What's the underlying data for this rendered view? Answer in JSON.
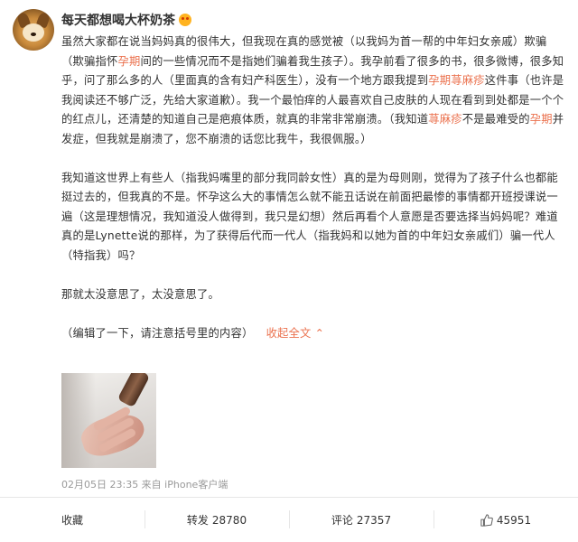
{
  "user": {
    "name": "每天都想喝大杯奶茶"
  },
  "post": {
    "paragraphs": [
      [
        {
          "t": "虽然大家都在说当妈妈真的很伟大，但我现在真的感觉被（以我妈为首一帮的中年妇女亲戚）欺骗（欺骗指怀"
        },
        {
          "t": "孕期",
          "kw": true
        },
        {
          "t": "间的一些情况而不是指她们骗着我生孩子）。我孕前看了很多的书，很多微博，很多知乎，问了那么多的人（里面真的含有妇产科医生），没有一个地方跟我提到"
        },
        {
          "t": "孕期荨麻疹",
          "kw": true
        },
        {
          "t": "这件事（也许是我阅读还不够广泛，先给大家道歉）。我一个最怕痒的人最喜欢自己皮肤的人现在看到到处都是一个个的红点儿，还清楚的知道自己是疤痕体质，就真的非常非常崩溃。（我知道"
        },
        {
          "t": "荨麻疹",
          "kw": true
        },
        {
          "t": "不是最难受的"
        },
        {
          "t": "孕期",
          "kw": true
        },
        {
          "t": "并发症，但我就是崩溃了，您不崩溃的话您比我牛，我很佩服。）"
        }
      ],
      [
        {
          "t": "我知道这世界上有些人（指我妈嘴里的部分我同龄女性）真的是为母则刚，觉得为了孩子什么也都能挺过去的，但我真的不是。怀孕这么大的事情怎么就不能丑话说在前面把最惨的事情都开班授课说一遍（这是理想情况，我知道没人做得到，我只是幻想）然后再看个人意愿是否要选择当妈妈呢？难道真的是Lynette说的那样，为了获得后代而一代人（指我妈和以她为首的中年妇女亲戚们）骗一代人（特指我）吗？"
        }
      ],
      [
        {
          "t": "那就太没意思了，太没意思了。"
        }
      ]
    ],
    "edit_note": "（编辑了一下，请注意括号里的内容）",
    "collapse_label": "收起全文",
    "collapse_symbol": "⌃",
    "meta": "02月05日 23:35 来自 iPhone客户端"
  },
  "actions": {
    "favorite": "收藏",
    "repost_label": "转发",
    "repost_count": "28780",
    "comment_label": "评论",
    "comment_count": "27357",
    "like_count": "45951"
  },
  "colors": {
    "keyword": "#eb7350",
    "meta": "#999999",
    "text": "#333333"
  }
}
